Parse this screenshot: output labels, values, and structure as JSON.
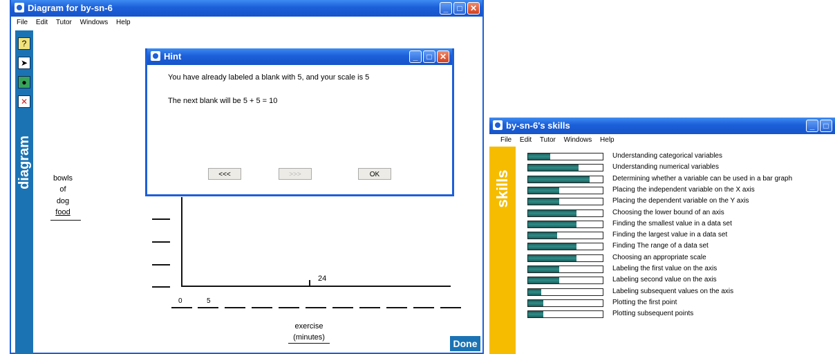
{
  "diagram_window": {
    "title": "Diagram for by-sn-6",
    "menu": [
      "File",
      "Edit",
      "Tutor",
      "Windows",
      "Help"
    ],
    "side_label": "diagram",
    "tools": [
      "hint-tool-icon",
      "select-arrow-icon",
      "add-point-icon",
      "delete-icon"
    ],
    "y_axis_label": [
      "bowls",
      "of",
      "dog",
      "food"
    ],
    "x_axis_label": [
      "exercise",
      "(minutes)"
    ],
    "x_tick_labels": [
      "0",
      "5"
    ],
    "point_label": "24",
    "done_label": "Done"
  },
  "hint_window": {
    "title": "Hint",
    "line1": "You have already labeled a blank with 5, and your scale is 5",
    "line2": "The next blank will be 5 + 5 = 10",
    "prev_label": "<<<",
    "next_label": ">>>",
    "ok_label": "OK"
  },
  "skills_window": {
    "title": "by-sn-6's skills",
    "menu": [
      "File",
      "Edit",
      "Tutor",
      "Windows",
      "Help"
    ],
    "side_label": "skills",
    "skills": [
      {
        "name": "Understanding categorical variables",
        "level": 0.3
      },
      {
        "name": "Understanding numerical variables",
        "level": 0.68
      },
      {
        "name": "Determining whether a variable can be used in a bar graph",
        "level": 0.82
      },
      {
        "name": "Placing the independent variable on the X axis",
        "level": 0.42
      },
      {
        "name": "Placing the dependent variable on the Y axis",
        "level": 0.42
      },
      {
        "name": "Choosing the lower bound of an axis",
        "level": 0.65
      },
      {
        "name": "Finding the smallest value in a data set",
        "level": 0.65
      },
      {
        "name": "Finding the largest value in a data set",
        "level": 0.39
      },
      {
        "name": "Finding The range of a data set",
        "level": 0.65
      },
      {
        "name": "Choosing an appropriate scale",
        "level": 0.65
      },
      {
        "name": "Labeling the first value on the axis",
        "level": 0.42
      },
      {
        "name": "Labeling second value on the axis",
        "level": 0.42
      },
      {
        "name": "Labeling subsequent values on the axis",
        "level": 0.18
      },
      {
        "name": "Plotting the first point",
        "level": 0.2
      },
      {
        "name": "Plotting subsequent points",
        "level": 0.2
      }
    ]
  }
}
